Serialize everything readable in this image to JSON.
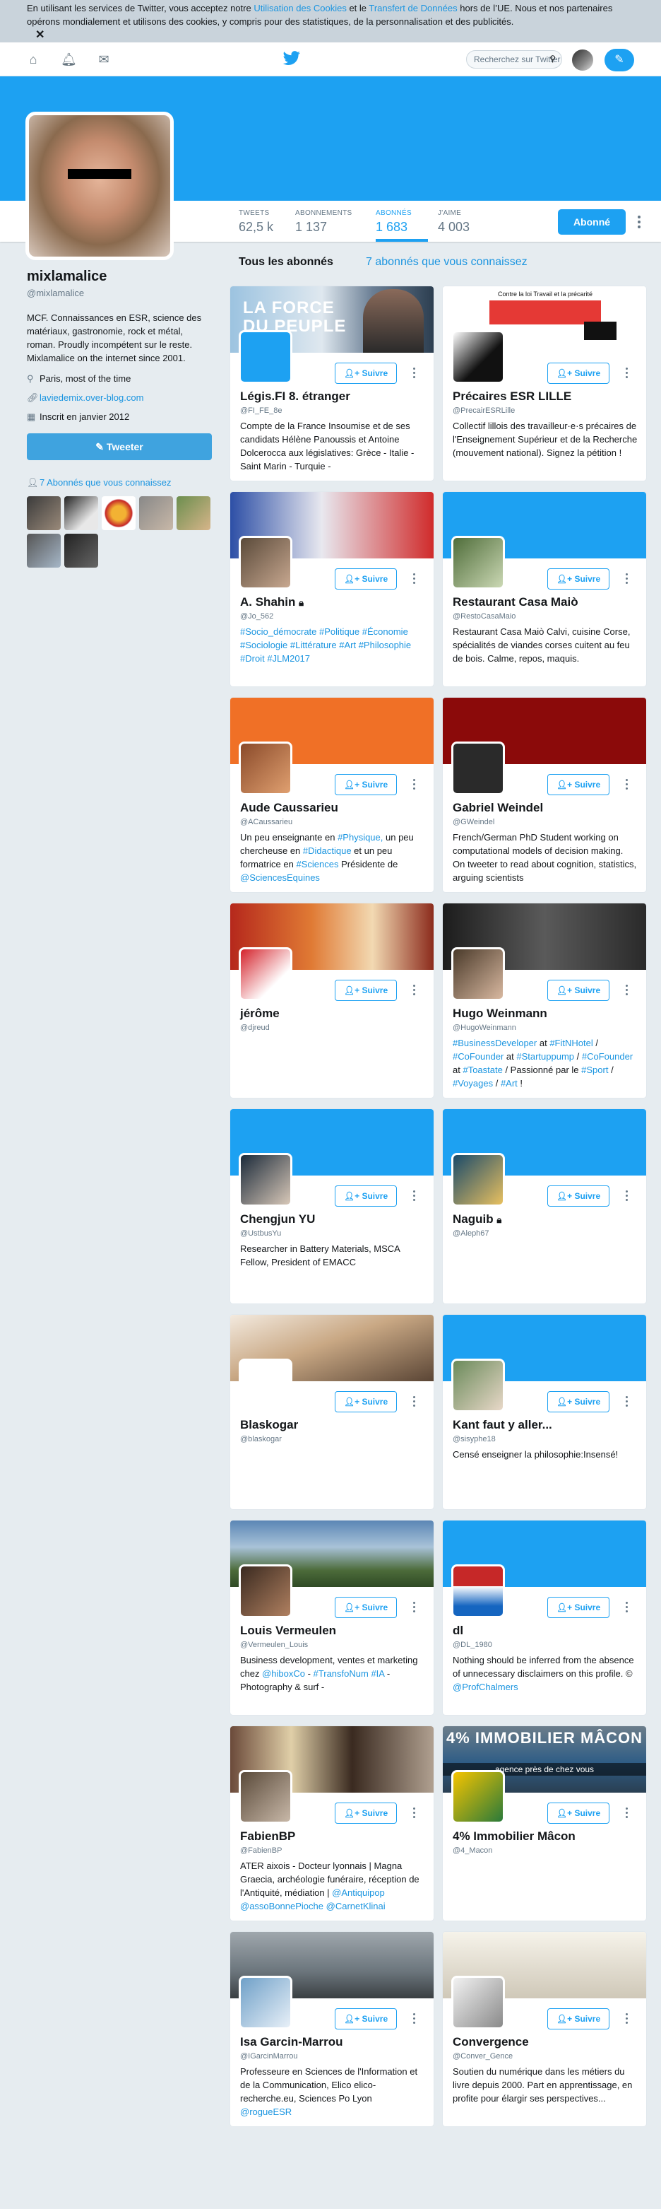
{
  "cookie": {
    "text_1": "En utilisant les services de Twitter, vous acceptez notre ",
    "link_1": "Utilisation des Cookies",
    "text_2": " et le ",
    "link_2": "Transfert de Données",
    "text_3": " hors de l’UE. Nous et nos partenaires opérons mondialement et utilisons des cookies, y compris pour des statistiques, de la personnalisation et des publicités.",
    "close": "✕"
  },
  "nav": {
    "search_placeholder": "Recherchez sur Twitter"
  },
  "profile": {
    "name": "mixlamalice",
    "handle": "@mixlamalice",
    "bio": "MCF. Connaissances en ESR, science des matériaux, gastronomie, rock et métal, roman. Proudly incompétent sur le reste. Mixlamalice on the internet since 2001.",
    "location": "Paris, most of the time",
    "website": "laviedemix.over-blog.com",
    "joined": "Inscrit en janvier 2012",
    "tweet_button": "Tweeter",
    "mutual_link": "7 Abonnés que vous connaissez"
  },
  "stats": [
    {
      "label": "TWEETS",
      "value": "62,5 k"
    },
    {
      "label": "ABONNEMENTS",
      "value": "1 137"
    },
    {
      "label": "ABONNÉS",
      "value": "1 683"
    },
    {
      "label": "J'AIME",
      "value": "4 003"
    }
  ],
  "following_button": "Abonné",
  "tabs": {
    "all": "Tous les abonnés",
    "known": "7 abonnés que vous connaissez"
  },
  "follow_label": "Suivre",
  "cards": [
    {
      "name": "Légis.FI 8. étranger",
      "handle": "@FI_FE_8e",
      "bio": "Compte de la France Insoumise et de ses candidats Hélène Panoussis et Antoine Dolcerocca aux législatives: Grèce - Italie - Saint Marin - Turquie -",
      "banner_text": "LA FORCE DU PEUPLE"
    },
    {
      "name": "Précaires ESR LILLE",
      "handle": "@PrecairESRLille",
      "bio": "Collectif lillois des travailleur·e·s précaires de l'Enseignement Supérieur et de la Recherche (mouvement national). Signez la pétition !",
      "banner_text": "Contre la loi Travail et la précarité"
    },
    {
      "name": "A. Shahin",
      "handle": "@Jo_562",
      "bio": "#Socio_démocrate #Politique #Économie #Sociologie #Littérature #Art #Philosophie #Droit #JLM2017"
    },
    {
      "name": "Restaurant Casa Maiò",
      "handle": "@RestoCasaMaio",
      "bio": "Restaurant Casa Maiò Calvi, cuisine Corse, spécialités de viandes corses cuitent au feu de bois. Calme, repos, maquis."
    },
    {
      "name": "Aude Caussarieu",
      "handle": "@ACaussarieu",
      "bio": "Un peu enseignante en #Physique, un peu chercheuse en #Didactique et un peu formatrice en #Sciences Présidente de @SciencesEquines"
    },
    {
      "name": "Gabriel Weindel",
      "handle": "@GWeindel",
      "bio": "French/German PhD Student working on computational models of decision making. On tweeter to read about cognition, statistics, arguing scientists"
    },
    {
      "name": "jérôme",
      "handle": "@djreud",
      "bio": ""
    },
    {
      "name": "Hugo Weinmann",
      "handle": "@HugoWeinmann",
      "bio": "#BusinessDeveloper at #FitNHotel / #CoFounder at #Startuppump / #CoFounder at #Toastate / Passionné par le #Sport / #Voyages / #Art !"
    },
    {
      "name": "Chengjun YU",
      "handle": "@UstbusYu",
      "bio": "Researcher in Battery Materials, MSCA Fellow, President of EMACC"
    },
    {
      "name": "Naguib",
      "handle": "@Aleph67",
      "bio": ""
    },
    {
      "name": "Blaskogar",
      "handle": "@blaskogar",
      "bio": ""
    },
    {
      "name": "Kant faut y aller...",
      "handle": "@sisyphe18",
      "bio": "Censé enseigner la philosophie:Insensé!"
    },
    {
      "name": "Louis Vermeulen",
      "handle": "@Vermeulen_Louis",
      "bio": "Business development, ventes et marketing chez @hiboxCo - #TransfoNum #IA - Photography & surf -"
    },
    {
      "name": "dl",
      "handle": "@DL_1980",
      "bio": "Nothing should be inferred from the absence of unnecessary disclaimers on this profile. © @ProfChalmers"
    },
    {
      "name": "FabienBP",
      "handle": "@FabienBP",
      "bio": "ATER aixois - Docteur lyonnais | Magna Graecia, archéologie funéraire, réception de l'Antiquité, médiation | @Antiquipop @assoBonnePioche @CarnetKlinai"
    },
    {
      "name": "4% Immobilier Mâcon",
      "handle": "@4_Macon",
      "bio": "",
      "banner_text": "4% IMMOBILIER MÂCON",
      "banner_sub": "agence près de chez vous"
    },
    {
      "name": "Isa Garcin-Marrou",
      "handle": "@IGarcinMarrou",
      "bio": "Professeure en Sciences de l'Information et de la Communication, Elico elico-recherche.eu, Sciences Po Lyon @rogueESR"
    },
    {
      "name": "Convergence",
      "handle": "@Conver_Gence",
      "bio": "Soutien du numérique dans les métiers du livre depuis 2000. Part en apprentissage, en profite pour élargir ses perspectives..."
    }
  ],
  "colors": {
    "accent": "#1da1f2",
    "link": "#1b95e0",
    "background": "#e6ecf0",
    "cookie_banner": "#c9d3db"
  },
  "icons": [
    "home-icon",
    "notifications-icon",
    "messages-icon",
    "twitter-bird-icon",
    "search-icon",
    "compose-icon",
    "location-icon",
    "link-icon",
    "calendar-icon",
    "people-icon",
    "add-user-icon",
    "lock-icon",
    "more-icon"
  ]
}
